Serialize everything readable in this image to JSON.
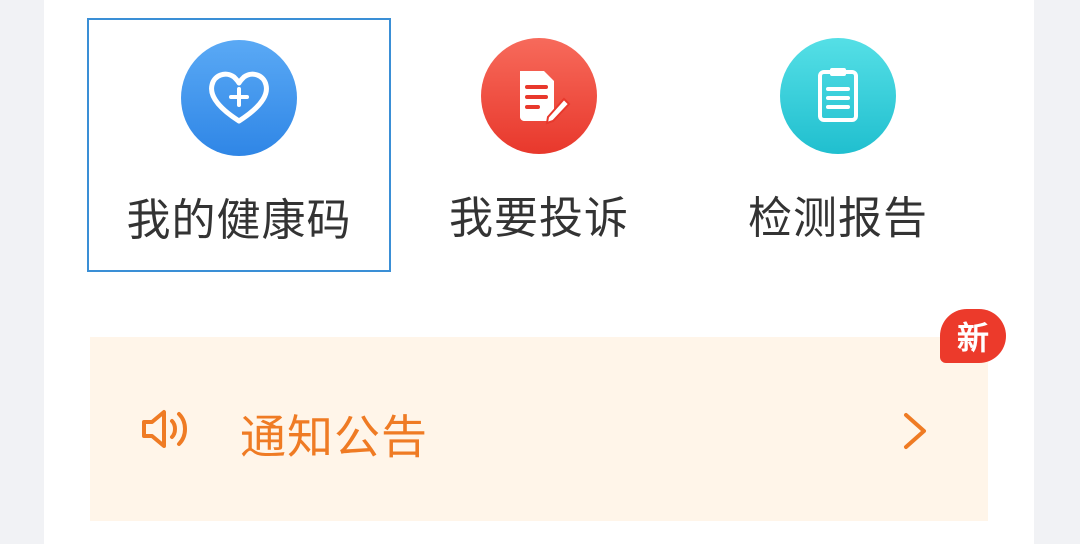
{
  "shortcuts": [
    {
      "label": "我的健康码",
      "icon": "heart-plus-icon",
      "color_top": "#5aa9f5",
      "color_bottom": "#2f86e6"
    },
    {
      "label": "我要投诉",
      "icon": "edit-document-icon",
      "color_top": "#f76a5b",
      "color_bottom": "#e8382c"
    },
    {
      "label": "检测报告",
      "icon": "report-list-icon",
      "color_top": "#55dfe6",
      "color_bottom": "#20bfcf"
    }
  ],
  "notice": {
    "title": "通知公告",
    "badge": "新",
    "icon": "speaker-icon",
    "chevron_icon": "chevron-right-icon",
    "accent_color": "#ef7b24",
    "background_color": "#fff5e9"
  }
}
